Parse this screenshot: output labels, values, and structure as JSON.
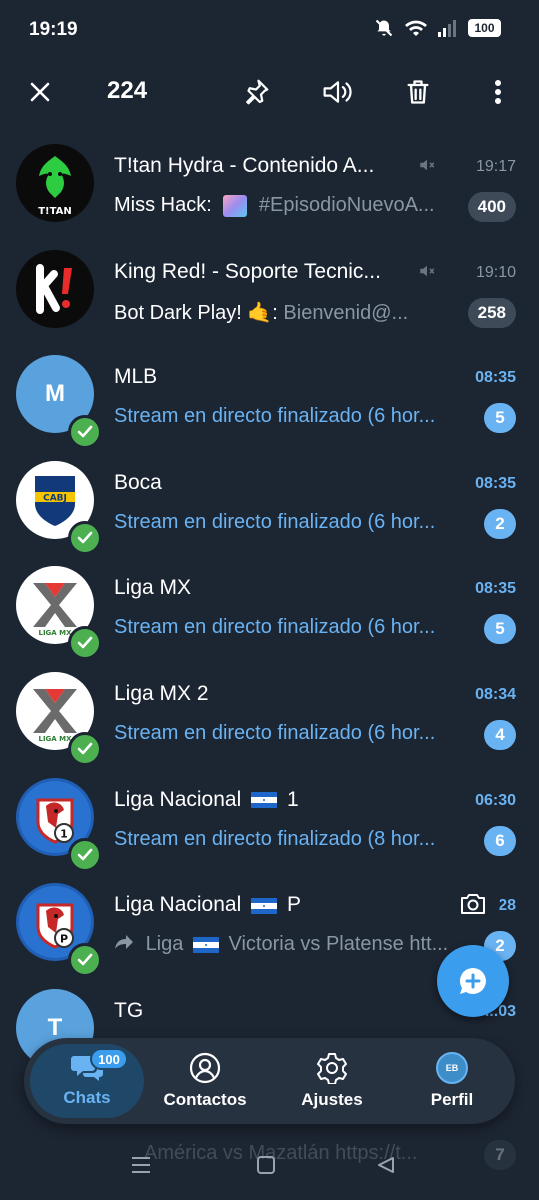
{
  "status_bar": {
    "time": "19:19",
    "battery": "100"
  },
  "action_bar": {
    "selected_count": "224"
  },
  "chats": [
    {
      "title": "T!tan Hydra - Contenido A...",
      "muted": true,
      "time": "19:17",
      "time_unread": false,
      "sender": "Miss Hack:",
      "preview": "#EpisodioNuevoA...",
      "badge": "400",
      "badge_style": "muted",
      "verified": false,
      "avatar_letter": ""
    },
    {
      "title": "King Red! - Soporte Tecnic...",
      "muted": true,
      "time": "19:10",
      "time_unread": false,
      "sender": "Bot Dark Play! 🤙:",
      "preview": "Bienvenid@...",
      "badge": "258",
      "badge_style": "muted",
      "verified": false,
      "avatar_letter": ""
    },
    {
      "title": "MLB",
      "muted": false,
      "time": "08:35",
      "time_unread": true,
      "sender": "",
      "preview": "Stream en directo finalizado (6 hor...",
      "badge": "5",
      "badge_style": "blue",
      "verified": true,
      "avatar_letter": "M",
      "avatar_color": "#5aa2de"
    },
    {
      "title": "Boca",
      "muted": false,
      "time": "08:35",
      "time_unread": true,
      "sender": "",
      "preview": "Stream en directo finalizado (6 hor...",
      "badge": "2",
      "badge_style": "blue",
      "verified": true,
      "avatar_letter": ""
    },
    {
      "title": "Liga MX",
      "muted": false,
      "time": "08:35",
      "time_unread": true,
      "sender": "",
      "preview": "Stream en directo finalizado (6 hor...",
      "badge": "5",
      "badge_style": "blue",
      "verified": true,
      "avatar_letter": ""
    },
    {
      "title": "Liga MX 2",
      "muted": false,
      "time": "08:34",
      "time_unread": true,
      "sender": "",
      "preview": "Stream en directo finalizado (6 hor...",
      "badge": "4",
      "badge_style": "blue",
      "verified": true,
      "avatar_letter": ""
    },
    {
      "title": "Liga Nacional",
      "title_suffix": "1",
      "muted": false,
      "time": "06:30",
      "time_unread": true,
      "sender": "",
      "preview": "Stream en directo finalizado (8 hor...",
      "badge": "6",
      "badge_style": "blue",
      "verified": true,
      "avatar_letter": ""
    },
    {
      "title": "Liga Nacional",
      "title_suffix": "P",
      "muted": false,
      "time": "...28",
      "time_unread": true,
      "sender": "",
      "preview_prefix": "Liga",
      "preview": "Victoria vs Platense  htt...",
      "badge": "2",
      "badge_style": "blue",
      "verified": true,
      "avatar_letter": ""
    },
    {
      "title": "TG",
      "muted": false,
      "time": "...03",
      "time_unread": true,
      "sender": "",
      "preview": "",
      "badge": "",
      "badge_style": "blue",
      "verified": false,
      "avatar_letter": "T",
      "avatar_color": "#5aa2de"
    }
  ],
  "ghost_row": {
    "preview": "América vs Mazatlán  https://t...",
    "badge": "7"
  },
  "bottom_nav": {
    "chats_label": "Chats",
    "chats_badge": "100",
    "contacts_label": "Contactos",
    "settings_label": "Ajustes",
    "profile_label": "Perfil",
    "profile_initials": "EB"
  },
  "colors": {
    "background": "#1c2532",
    "accent": "#6ab3f3",
    "fab": "#3b9ded",
    "verified": "#4caf50"
  }
}
